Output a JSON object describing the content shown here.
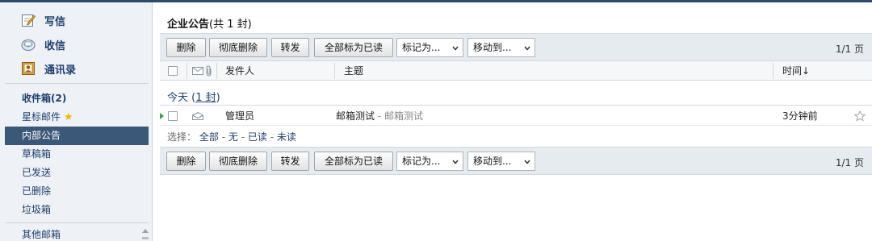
{
  "sidebar": {
    "actions": [
      {
        "label": "写信",
        "icon": "compose-icon"
      },
      {
        "label": "收信",
        "icon": "receive-mail-icon"
      },
      {
        "label": "通讯录",
        "icon": "contacts-icon"
      }
    ],
    "folders": [
      {
        "label": "收件箱(2)",
        "name": "folder-inbox",
        "bold": true
      },
      {
        "label": "星标邮件",
        "name": "folder-starred",
        "icon": "star-icon"
      },
      {
        "label": "内部公告",
        "name": "folder-internal-notices",
        "active": true
      },
      {
        "label": "草稿箱",
        "name": "folder-drafts"
      },
      {
        "label": "已发送",
        "name": "folder-sent"
      },
      {
        "label": "已删除",
        "name": "folder-deleted"
      },
      {
        "label": "垃圾箱",
        "name": "folder-spam"
      },
      {
        "label": "其他邮箱",
        "name": "folder-other-mailboxes"
      }
    ]
  },
  "main": {
    "title": "企业公告",
    "title_count": "(共 1 封)",
    "toolbar": {
      "delete": "删除",
      "delete_permanently": "彻底删除",
      "forward": "转发",
      "mark_all_read": "全部标为已读",
      "mark_as": "标记为...",
      "move_to": "移动到...",
      "pager": "1/1 页"
    },
    "columns": {
      "sender": "发件人",
      "subject": "主题",
      "time": "时间↓"
    },
    "group": {
      "label": "今天",
      "count": "1 封"
    },
    "messages": [
      {
        "sender": "管理员",
        "subject": "邮箱测试",
        "separator": "-",
        "preview": "邮箱测试",
        "time": "3分钟前"
      }
    ],
    "select": {
      "label": "选择：",
      "all": "全部",
      "none": "无",
      "read": "已读",
      "unread": "未读",
      "dash": "-"
    }
  }
}
